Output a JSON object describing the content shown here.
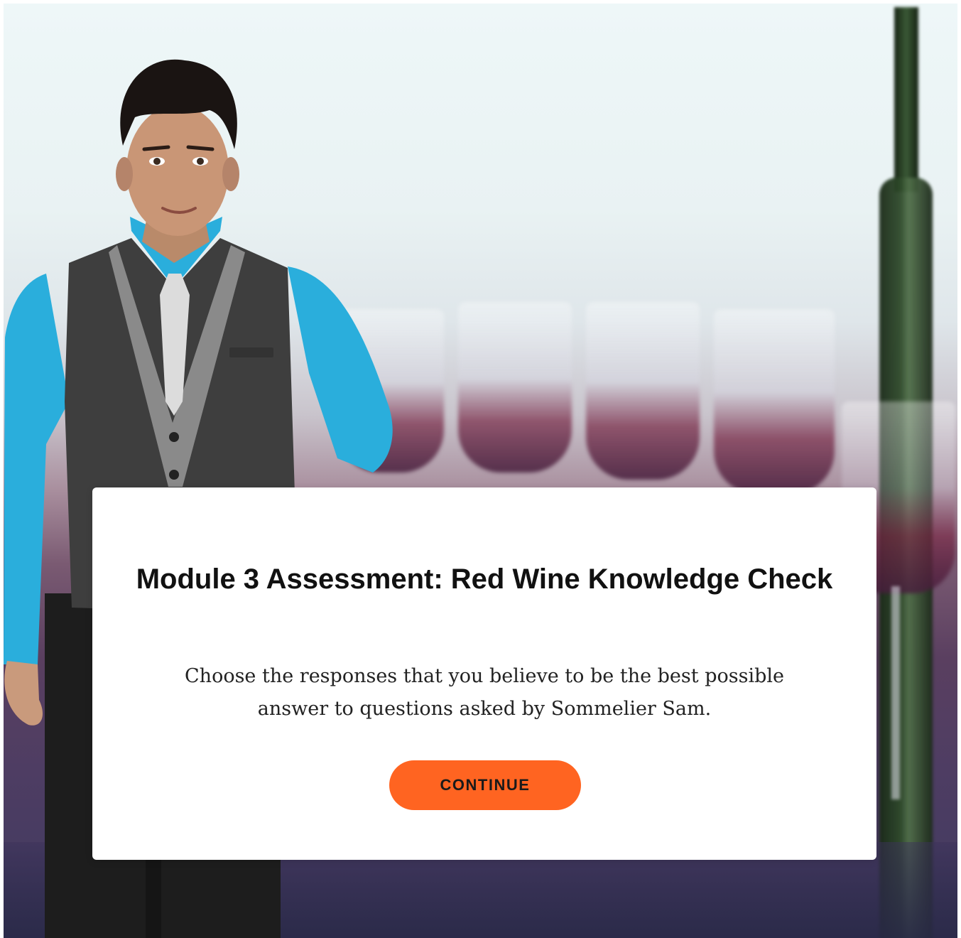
{
  "dialog": {
    "title": "Module 3 Assessment: Red Wine Knowledge Check",
    "body": "Choose the responses that you believe to be the best possible answer to questions asked by Sommelier Sam.",
    "continue_label": "CONTINUE"
  },
  "colors": {
    "button_background": "#ff6421",
    "button_text": "#1a1a1a",
    "dialog_background": "#ffffff",
    "title_text": "#111111"
  },
  "scene": {
    "background": "wine-glasses-restaurant",
    "character": "sommelier-sam"
  }
}
